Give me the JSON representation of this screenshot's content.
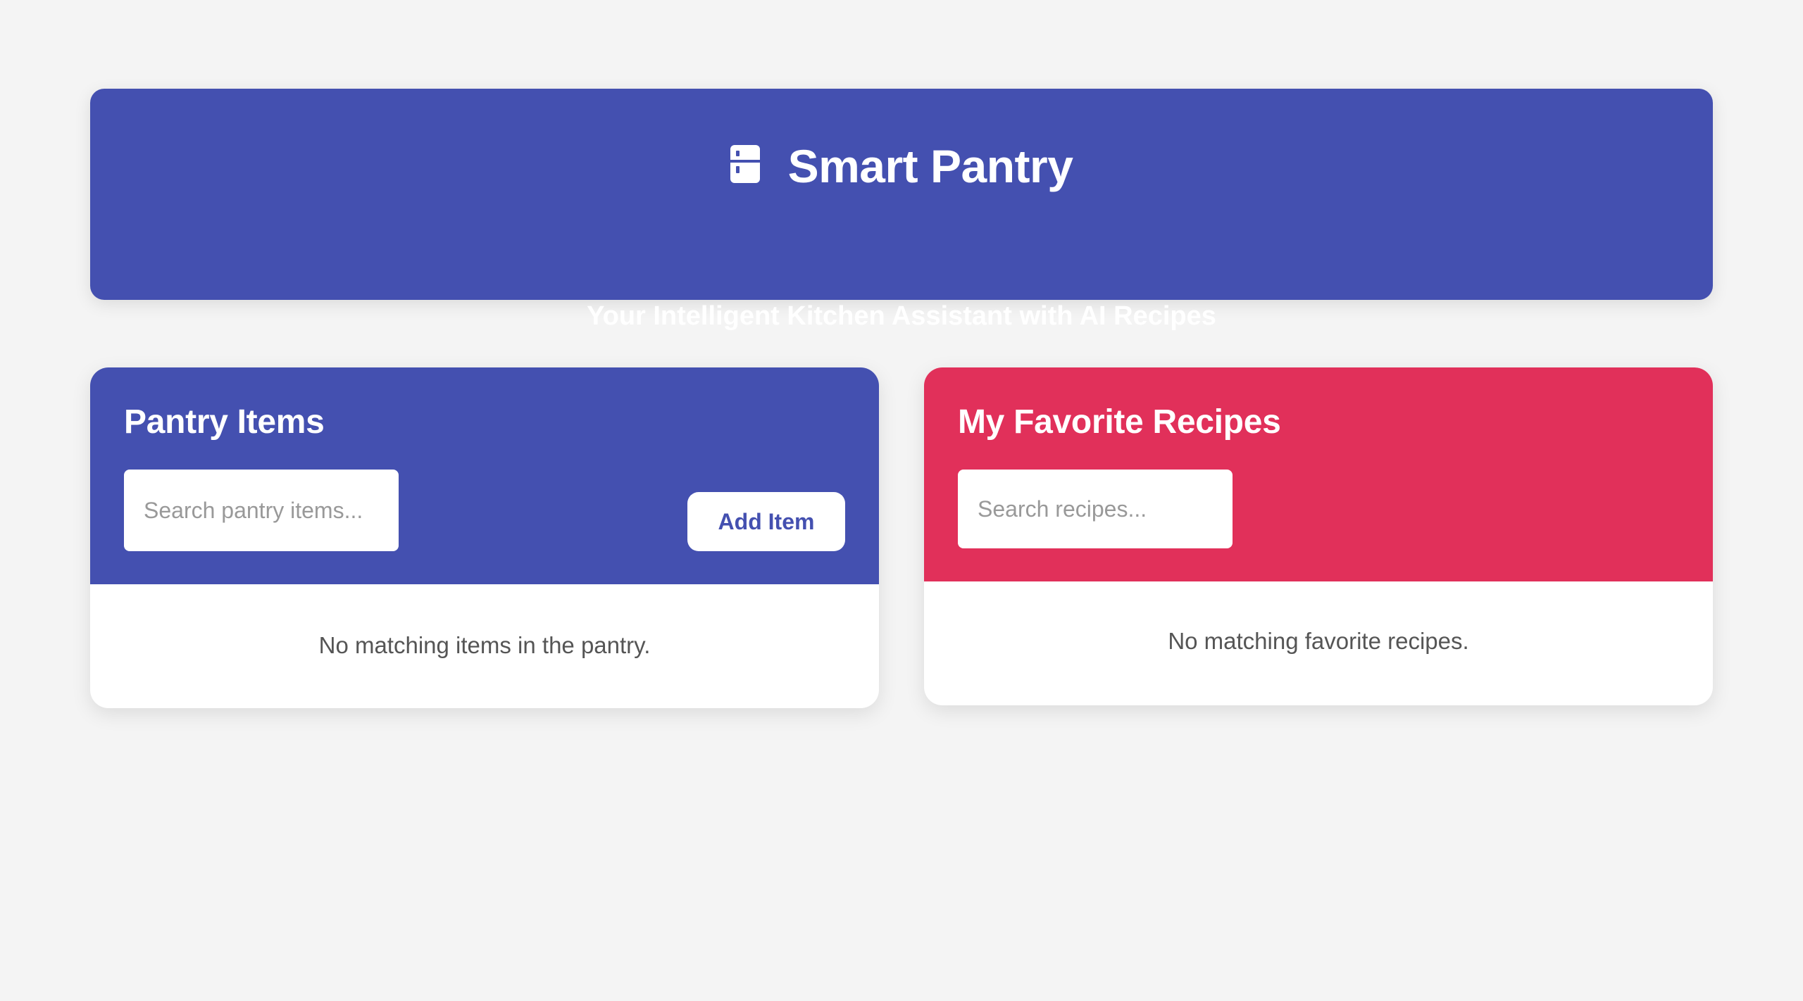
{
  "header": {
    "icon": "fridge-icon",
    "title": "Smart Pantry",
    "subtitle": "Your Intelligent Kitchen Assistant with AI Recipes"
  },
  "pantry": {
    "title": "Pantry Items",
    "search_placeholder": "Search pantry items...",
    "search_value": "",
    "add_label": "Add Item",
    "empty_message": "No matching items in the pantry."
  },
  "recipes": {
    "title": "My Favorite Recipes",
    "search_placeholder": "Search recipes...",
    "search_value": "",
    "empty_message": "No matching favorite recipes."
  },
  "colors": {
    "page_background": "#f4f4f4",
    "primary": "#4450b0",
    "accent": "#e1305a",
    "text_muted": "#555555"
  }
}
